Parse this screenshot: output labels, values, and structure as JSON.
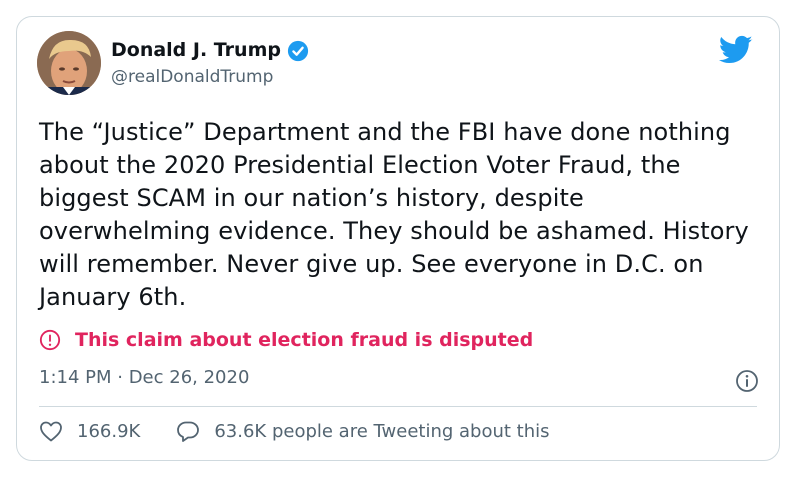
{
  "author": {
    "name": "Donald J. Trump",
    "handle": "@realDonaldTrump",
    "verified": true,
    "avatar_icon": "avatar-photo"
  },
  "tweet": {
    "text": "The “Justice” Department and the FBI have done nothing about the 2020 Presidential Election Voter Fraud, the biggest SCAM in our nation’s history, despite overwhelming evidence. They should be ashamed. History will remember. Never give up. See everyone in D.C. on January 6th.",
    "notice": "This claim about election fraud is disputed",
    "timestamp": "1:14 PM · Dec 26, 2020"
  },
  "stats": {
    "likes": "166.9K",
    "replies_text": "63.6K people are Tweeting about this"
  },
  "colors": {
    "accent": "#1d9bf0",
    "notice": "#e0245e",
    "secondary_text": "#536471",
    "border": "#cfd9de"
  },
  "icons": {
    "brand": "twitter-bird-icon",
    "verified": "verified-badge-icon",
    "notice": "alert-circle-icon",
    "info": "info-icon",
    "like": "heart-icon",
    "reply": "speech-bubble-icon"
  }
}
